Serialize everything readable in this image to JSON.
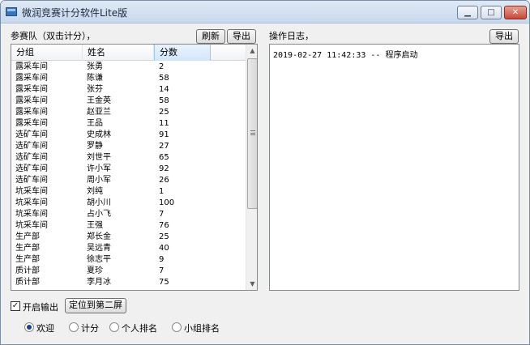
{
  "window": {
    "title": "微润竞赛计分软件Lite版",
    "controls": {
      "minimize": "▁",
      "maximize": "□",
      "close": "✕"
    }
  },
  "teams": {
    "label": "参赛队（双击计分），",
    "refresh_label": "刷新",
    "export_label": "导出",
    "columns": [
      "分组",
      "姓名",
      "分数"
    ],
    "rows": [
      [
        "露采车间",
        "张勇",
        "2"
      ],
      [
        "露采车间",
        "陈谦",
        "58"
      ],
      [
        "露采车间",
        "张芬",
        "14"
      ],
      [
        "露采车间",
        "王金英",
        "58"
      ],
      [
        "露采车间",
        "赵亚兰",
        "25"
      ],
      [
        "露采车间",
        "王品",
        "11"
      ],
      [
        "选矿车间",
        "史成林",
        "91"
      ],
      [
        "选矿车间",
        "罗静",
        "27"
      ],
      [
        "选矿车间",
        "刘世平",
        "65"
      ],
      [
        "选矿车间",
        "许小军",
        "92"
      ],
      [
        "选矿车间",
        "周小军",
        "26"
      ],
      [
        "坑采车间",
        "刘纯",
        "1"
      ],
      [
        "坑采车间",
        "胡小川",
        "100"
      ],
      [
        "坑采车间",
        "占小飞",
        "7"
      ],
      [
        "坑采车间",
        "王强",
        "76"
      ],
      [
        "生产部",
        "郑长金",
        "25"
      ],
      [
        "生产部",
        "吴远青",
        "40"
      ],
      [
        "生产部",
        "徐志平",
        "9"
      ],
      [
        "质计部",
        "夏珍",
        "7"
      ],
      [
        "质计部",
        "李月冰",
        "75"
      ]
    ]
  },
  "log": {
    "label": "操作日志，",
    "export_label": "导出",
    "entries": [
      "2019-02-27 11:42:33 -- 程序启动"
    ]
  },
  "options": {
    "enable_output_label": "开启输出",
    "enable_output_checked": true,
    "locate_button_label": "定位到第二屏"
  },
  "modes": {
    "selected": "欢迎",
    "items": [
      "欢迎",
      "计分",
      "个人排名",
      "小组排名"
    ]
  },
  "icons": {
    "scroll_up": "▲",
    "scroll_down": "▼",
    "check": "✓"
  }
}
